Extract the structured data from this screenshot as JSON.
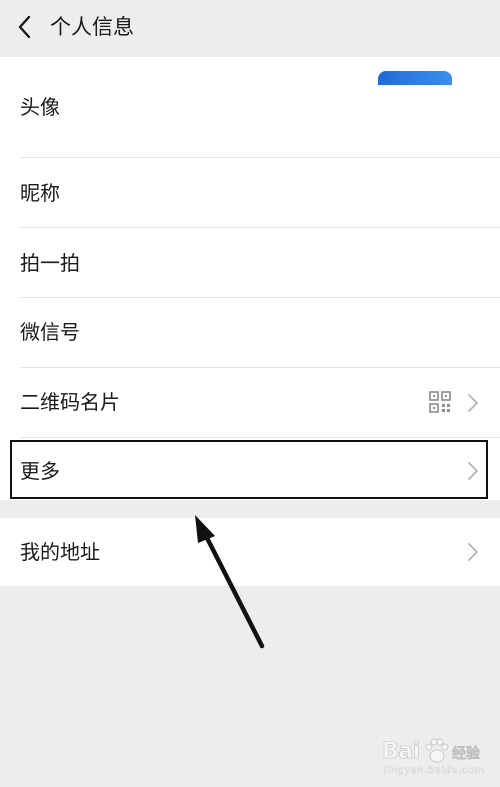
{
  "header": {
    "title": "个人信息",
    "back_icon": "chevron-left-icon"
  },
  "profile": {
    "rows": [
      {
        "label": "头像"
      },
      {
        "label": "昵称"
      },
      {
        "label": "拍一拍"
      },
      {
        "label": "微信号"
      },
      {
        "label": "二维码名片"
      },
      {
        "label": "更多"
      }
    ]
  },
  "address": {
    "label": "我的地址"
  },
  "annotation": {
    "highlight_color": "#111111",
    "arrow_color": "#111111"
  },
  "watermark": {
    "logo_text": "Bai",
    "logo_rest": "经验",
    "url": "jingyan.baidu.com"
  },
  "colors": {
    "background": "#ededed",
    "row_background": "#ffffff",
    "text": "#1a1a1a",
    "divider": "#e6e6e6",
    "chevron": "#b2b2b2",
    "avatar_accent": "#2b7be4"
  }
}
